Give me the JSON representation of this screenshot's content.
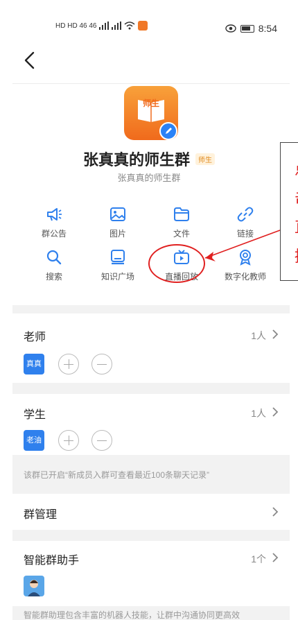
{
  "status_bar": {
    "left_text": "HD HD 46 46",
    "time": "8:54"
  },
  "group": {
    "avatar_text": "师生",
    "name": "张真真的师生群",
    "tag": "师生",
    "subtitle": "张真真的师生群"
  },
  "features": [
    {
      "label": "群公告",
      "icon": "megaphone-icon"
    },
    {
      "label": "图片",
      "icon": "image-icon"
    },
    {
      "label": "文件",
      "icon": "folder-icon"
    },
    {
      "label": "链接",
      "icon": "link-icon"
    },
    {
      "label": "搜索",
      "icon": "search-icon"
    },
    {
      "label": "知识广场",
      "icon": "knowledge-icon"
    },
    {
      "label": "直播回放",
      "icon": "tv-replay-icon"
    },
    {
      "label": "数字化教师",
      "icon": "badge-icon"
    }
  ],
  "callout": {
    "lines": [
      "点",
      "击",
      "直",
      "播"
    ]
  },
  "teachers": {
    "title": "老师",
    "count": "1人",
    "members": [
      "真真"
    ]
  },
  "students": {
    "title": "学生",
    "count": "1人",
    "members": [
      "老油"
    ]
  },
  "history_note": "该群已开启“新成员入群可查看最近100条聊天记录”",
  "group_manage": {
    "title": "群管理"
  },
  "assistant": {
    "title": "智能群助手",
    "count": "1个",
    "footer": "智能群助理包含丰富的机器人技能，让群中沟通协同更高效"
  },
  "colors": {
    "accent_blue": "#2f80ed",
    "highlight_red": "#e02020",
    "avatar_orange": "#f06a1c"
  }
}
